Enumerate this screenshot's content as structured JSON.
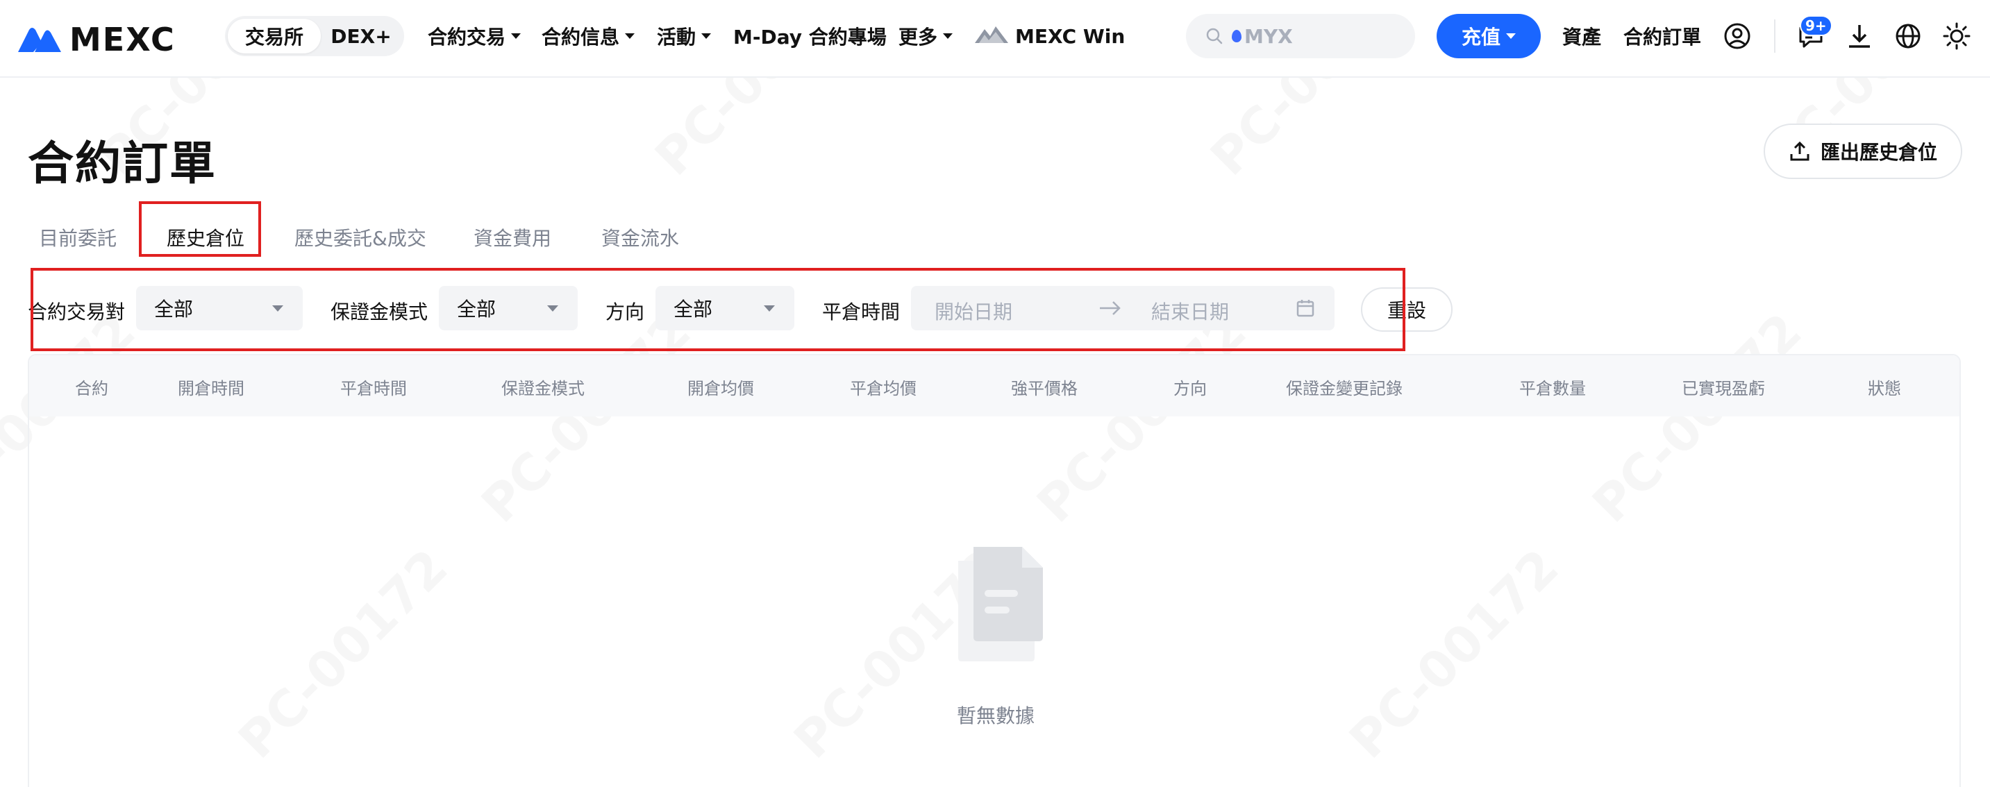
{
  "header": {
    "logo_text": "MEXC",
    "segment": [
      "交易所",
      "DEX+"
    ],
    "nav": [
      "合約交易",
      "合約信息",
      "活動",
      "M-Day 合約專場",
      "更多",
      "MEXC Win"
    ],
    "search_placeholder": "MYX",
    "deposit_label": "充值",
    "assets_label": "資產",
    "orders_label": "合約訂單",
    "notification_count": "9+"
  },
  "page": {
    "title": "合約訂單",
    "export_label": "匯出歷史倉位",
    "tabs": [
      "目前委託",
      "歷史倉位",
      "歷史委託&成交",
      "資金費用",
      "資金流水"
    ],
    "active_tab": "歷史倉位"
  },
  "filters": {
    "pair_label": "合約交易對",
    "pair_value": "全部",
    "margin_label": "保證金模式",
    "margin_value": "全部",
    "direction_label": "方向",
    "direction_value": "全部",
    "close_time_label": "平倉時間",
    "start_placeholder": "開始日期",
    "end_placeholder": "結束日期",
    "reset_label": "重設"
  },
  "table": {
    "columns": [
      "合約",
      "開倉時間",
      "平倉時間",
      "保證金模式",
      "開倉均價",
      "平倉均價",
      "強平價格",
      "方向",
      "保證金變更記錄",
      "平倉數量",
      "已實現盈虧",
      "狀態"
    ],
    "empty_text": "暫無數據"
  },
  "watermark": "PC-00172",
  "colors": {
    "accent": "#1a66ff",
    "highlight_box": "#e02020"
  }
}
